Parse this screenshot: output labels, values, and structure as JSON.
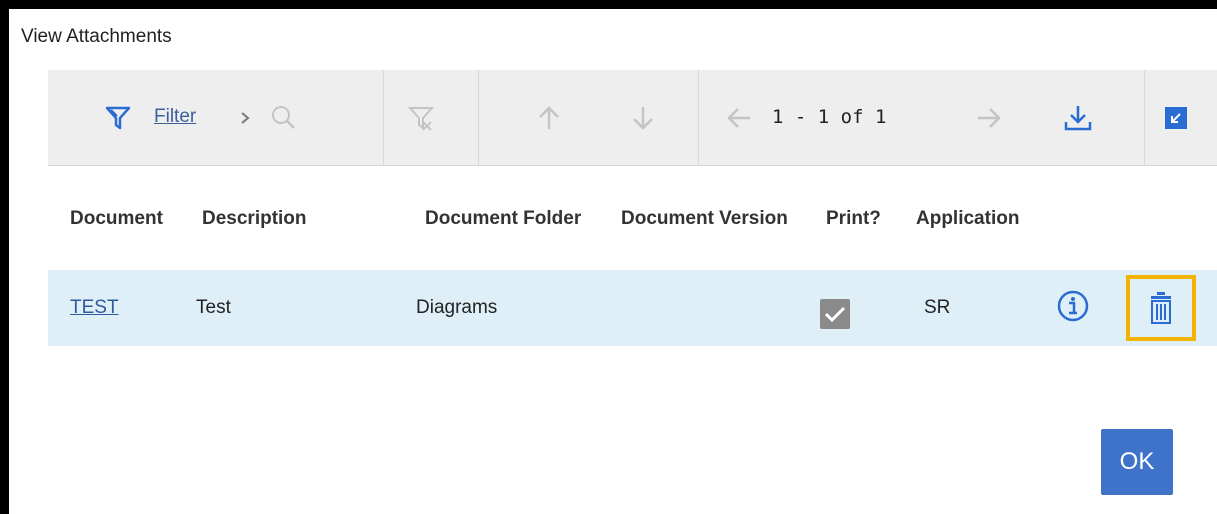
{
  "dialog": {
    "title": "View Attachments"
  },
  "toolbar": {
    "filter_label": "Filter",
    "pager_text": "1 - 1 of 1",
    "icons": [
      "filter-icon",
      "chevron-right-icon",
      "search-icon",
      "clear-filter-icon",
      "arrow-up-icon",
      "arrow-down-icon",
      "arrow-left-icon",
      "arrow-right-icon",
      "download-icon",
      "minimize-icon"
    ]
  },
  "table": {
    "columns": [
      "Document",
      "Description",
      "Document Folder",
      "Document Version",
      "Print?",
      "Application"
    ],
    "rows": [
      {
        "document": "TEST",
        "description": "Test",
        "folder": "Diagrams",
        "version": "",
        "print": true,
        "application": "SR"
      }
    ]
  },
  "footer": {
    "ok_label": "OK"
  },
  "colors": {
    "accent": "#3f73c9",
    "row_highlight": "#deeff8",
    "focus_outline": "#f2b400",
    "icon_blue": "#2b6cd3"
  }
}
